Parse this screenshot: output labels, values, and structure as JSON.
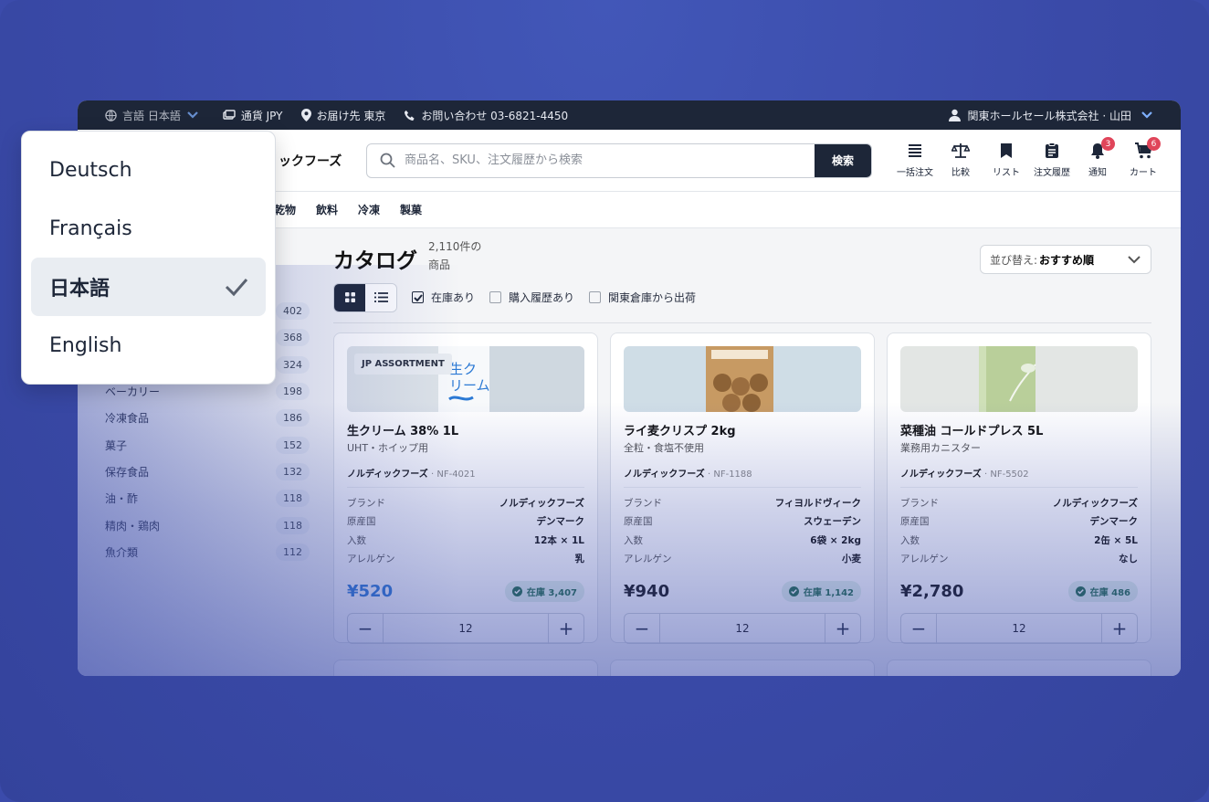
{
  "topbar": {
    "language": "言語 日本語",
    "currency": "通貨 JPY",
    "delivery": "お届け先 東京",
    "contact": "お問い合わせ 03-6821-4450",
    "account": "関東ホールセール株式会社 · 山田"
  },
  "header": {
    "logo_text": "ックフーズ",
    "search_placeholder": "商品名、SKU、注文履歴から検索",
    "search_button": "検索",
    "icons": [
      {
        "label": "一括注文",
        "icon": "list-icon"
      },
      {
        "label": "比較",
        "icon": "scale-icon"
      },
      {
        "label": "リスト",
        "icon": "bookmark-icon"
      },
      {
        "label": "注文履歴",
        "icon": "clipboard-icon"
      },
      {
        "label": "通知",
        "icon": "bell-icon",
        "badge": "3"
      },
      {
        "label": "カート",
        "icon": "cart-icon",
        "badge": "6"
      }
    ]
  },
  "catnav": [
    "乾物",
    "飲料",
    "冷凍",
    "製菓"
  ],
  "sidebar": [
    {
      "label": "",
      "count": "402"
    },
    {
      "label": "",
      "count": "368"
    },
    {
      "label": "",
      "count": "324"
    },
    {
      "label": "ベーカリー",
      "count": "198"
    },
    {
      "label": "冷凍食品",
      "count": "186"
    },
    {
      "label": "菓子",
      "count": "152"
    },
    {
      "label": "保存食品",
      "count": "132"
    },
    {
      "label": "油・酢",
      "count": "118"
    },
    {
      "label": "精肉・鶏肉",
      "count": "118"
    },
    {
      "label": "魚介類",
      "count": "112"
    }
  ],
  "main": {
    "title": "カタログ",
    "count": "2,110件の",
    "count2": "商品",
    "sort_prefix": "並び替え:",
    "sort_value": "おすすめ順",
    "filters": [
      {
        "label": "在庫あり",
        "checked": true
      },
      {
        "label": "購入履歴あり",
        "checked": false
      },
      {
        "label": "関東倉庫から出荷",
        "checked": false
      }
    ]
  },
  "products": [
    {
      "tag": "JP ASSORTMENT",
      "name": "生クリーム 38% 1L",
      "desc": "UHT・ホイップ用",
      "brand": "ノルディックフーズ",
      "sku": " · NF-4021",
      "specs": [
        {
          "k": "ブランド",
          "v": "ノルディックフーズ"
        },
        {
          "k": "原産国",
          "v": "デンマーク"
        },
        {
          "k": "入数",
          "v": "12本 × 1L"
        },
        {
          "k": "アレルゲン",
          "v": "乳"
        }
      ],
      "price": "¥520",
      "stock": "在庫 3,407",
      "qty": "12",
      "image_color": "#dde3e8"
    },
    {
      "tag": "",
      "name": "ライ麦クリスプ 2kg",
      "desc": "全粒・食塩不使用",
      "brand": "ノルディックフーズ",
      "sku": " · NF-1188",
      "specs": [
        {
          "k": "ブランド",
          "v": "フィヨルドヴィーク"
        },
        {
          "k": "原産国",
          "v": "スウェーデン"
        },
        {
          "k": "入数",
          "v": "6袋 × 2kg"
        },
        {
          "k": "アレルゲン",
          "v": "小麦"
        }
      ],
      "price": "¥940",
      "stock": "在庫 1,142",
      "qty": "12",
      "image_color": "#cfdde6"
    },
    {
      "tag": "",
      "name": "菜種油 コールドプレス 5L",
      "desc": "業務用カニスター",
      "brand": "ノルディックフーズ",
      "sku": " · NF-5502",
      "specs": [
        {
          "k": "ブランド",
          "v": "ノルディックフーズ"
        },
        {
          "k": "原産国",
          "v": "デンマーク"
        },
        {
          "k": "入数",
          "v": "2缶 × 5L"
        },
        {
          "k": "アレルゲン",
          "v": "なし"
        }
      ],
      "price": "¥2,780",
      "stock": "在庫 486",
      "qty": "12",
      "image_color": "#e3e6e4"
    }
  ],
  "language_menu": {
    "options": [
      "Deutsch",
      "Français",
      "日本語",
      "English"
    ],
    "selected": "日本語"
  }
}
